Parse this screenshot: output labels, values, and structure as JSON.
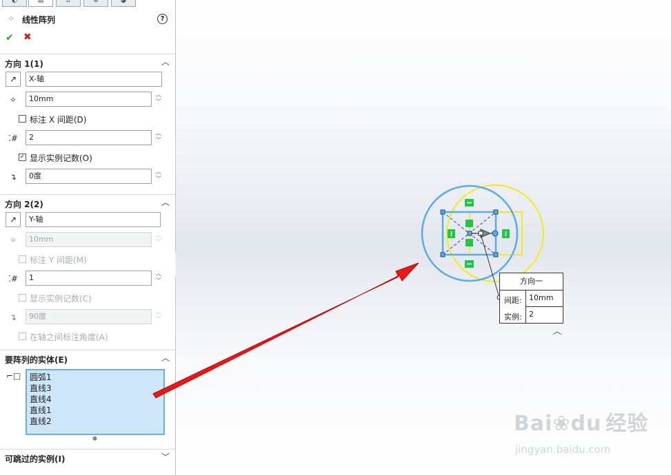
{
  "tabs": [
    "feature-manager",
    "property-manager",
    "configuration-manager",
    "dimxpert-manager",
    "display-manager"
  ],
  "panel": {
    "title": "线性阵列",
    "help_label": "?",
    "ok_symbol": "✔",
    "cancel_symbol": "✖",
    "dir1": {
      "header": "方向 1(1)",
      "axis_value": "X-轴",
      "spacing_value": "10mm",
      "dim_x_label": "标注 X 间距(D)",
      "dim_x_checked": false,
      "count_value": "2",
      "show_count_label": "显示实例记数(O)",
      "show_count_checked": true,
      "angle_value": "0度"
    },
    "dir2": {
      "header": "方向 2(2)",
      "axis_value": "Y-轴",
      "spacing_value": "10mm",
      "dim_y_label": "标注 Y 间距(M)",
      "count_value": "1",
      "show_count_label": "显示实例记数(C)",
      "angle_value": "90度",
      "dim_angle_label": "在轴之间标注角度(A)"
    },
    "entities": {
      "header": "要阵列的实体(E)",
      "items": [
        "圆弧1",
        "直线3",
        "直线4",
        "直线1",
        "直线2"
      ]
    },
    "skip": {
      "header": "可跳过的实例(I)"
    }
  },
  "callout": {
    "title": "方向一",
    "spacing_label": "间距:",
    "spacing_value": "10mm",
    "count_label": "实例:",
    "count_value": "2"
  },
  "watermark": {
    "brand": "Bai",
    "brand2": "du",
    "brand_cn": "经验",
    "url": "jingyan.baidu.com"
  },
  "colors": {
    "sketch_blue": "#5aaae8",
    "preview_yellow": "#f2ea1a",
    "relation_green": "#22c44a",
    "arrow_red": "#e51b1b",
    "selection_fill": "#cfe5f8"
  }
}
